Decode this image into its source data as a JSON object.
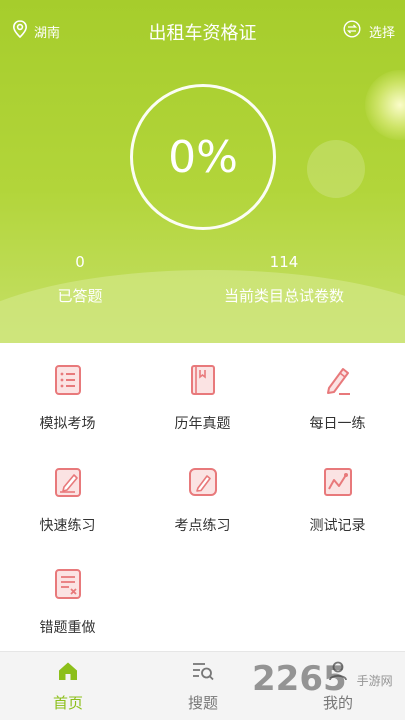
{
  "header": {
    "location": "湖南",
    "title": "出租车资格证",
    "choose_label": "选择"
  },
  "progress": {
    "percent_text": "0%",
    "percent": 0
  },
  "stats": {
    "answered": {
      "value": "0",
      "label": "已答题"
    },
    "total": {
      "value": "114",
      "label": "当前类目总试卷数"
    }
  },
  "menu": [
    {
      "label": "模拟考场",
      "icon": "list-sheet-icon"
    },
    {
      "label": "历年真题",
      "icon": "book-icon"
    },
    {
      "label": "每日一练",
      "icon": "pencil-icon"
    },
    {
      "label": "快速练习",
      "icon": "edit-note-icon"
    },
    {
      "label": "考点练习",
      "icon": "pen-square-icon"
    },
    {
      "label": "测试记录",
      "icon": "line-chart-icon"
    },
    {
      "label": "错题重做",
      "icon": "error-note-icon"
    }
  ],
  "tabbar": {
    "home": "首页",
    "search": "搜题",
    "mine": "我的"
  },
  "watermark": {
    "brand": "2265",
    "site": "手游网"
  },
  "colors": {
    "accent_green": "#a6cd2c",
    "icon_red": "#e8797b",
    "active_tab": "#8cbf1a"
  }
}
